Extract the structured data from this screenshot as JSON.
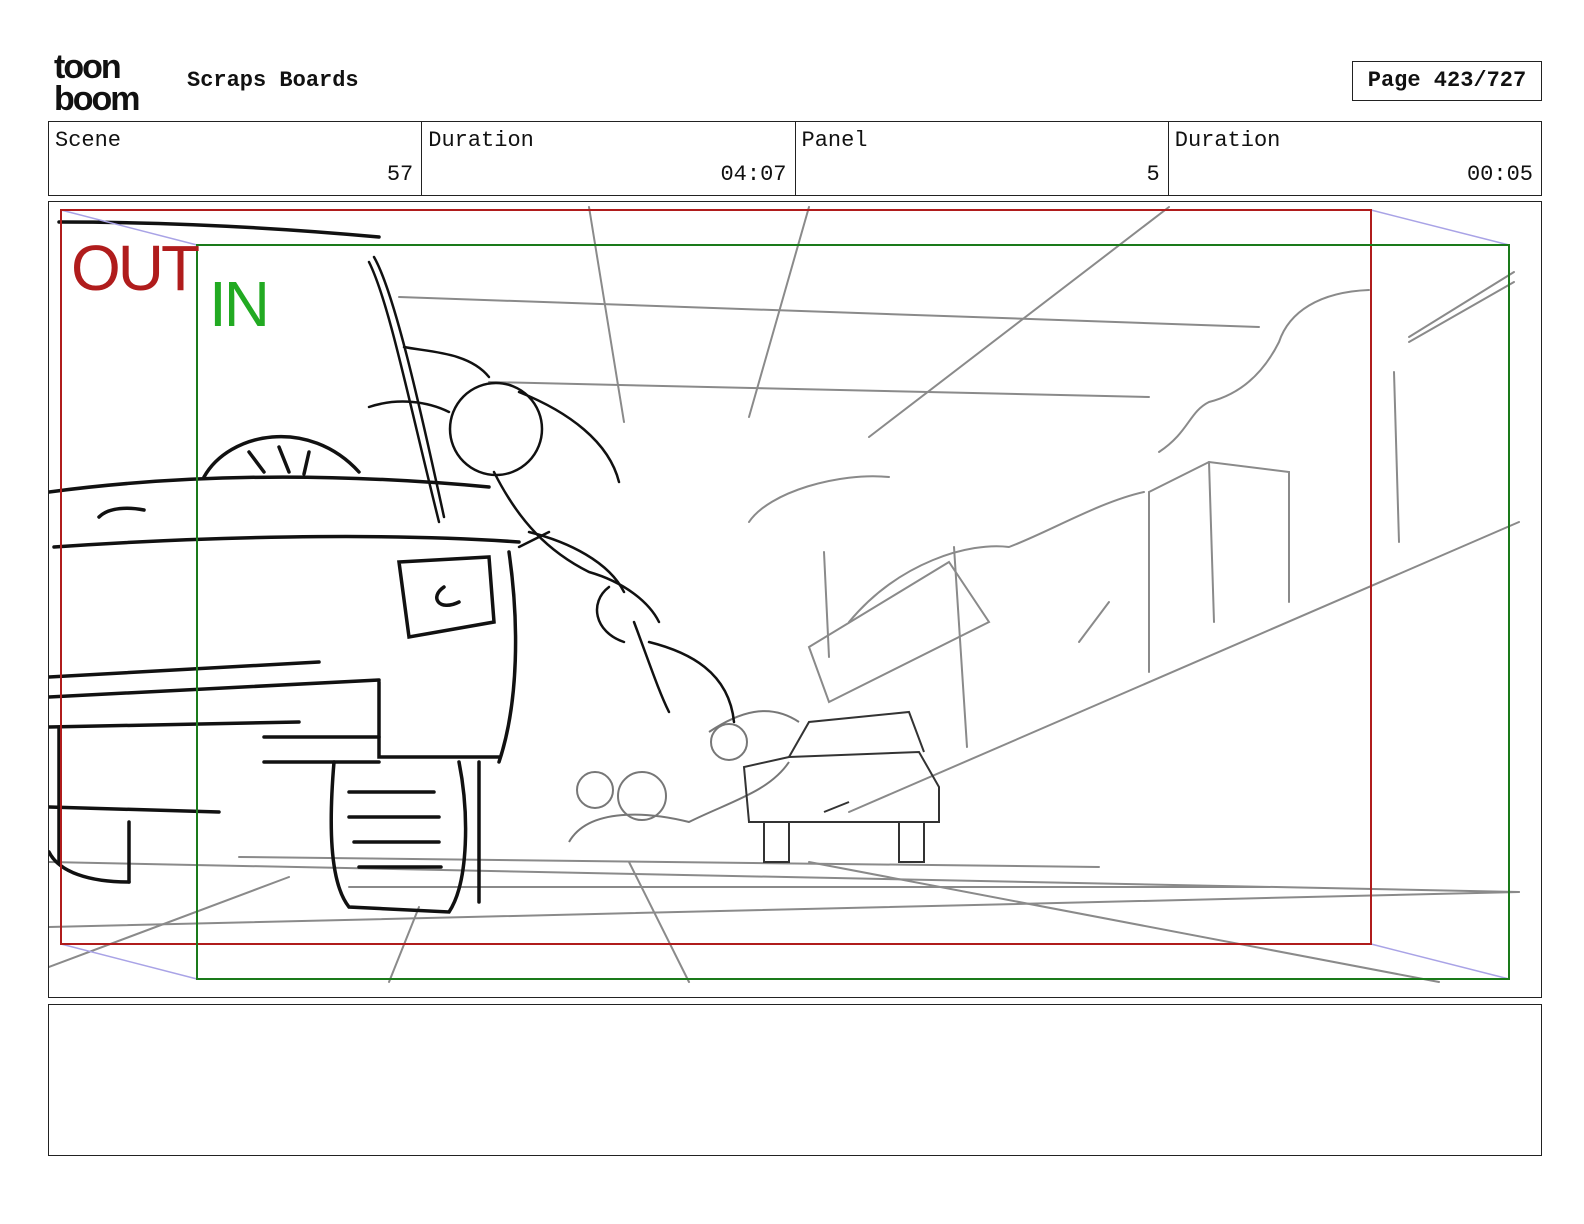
{
  "header": {
    "logo_top": "toon",
    "logo_bottom": "boom",
    "project_title": "Scraps Boards",
    "page_label": "Page 423/727"
  },
  "info": {
    "scene_label": "Scene",
    "scene_value": "57",
    "scene_duration_label": "Duration",
    "scene_duration_value": "04:07",
    "panel_label": "Panel",
    "panel_value": "5",
    "panel_duration_label": "Duration",
    "panel_duration_value": "00:05"
  },
  "panel": {
    "out_label": "OUT",
    "in_label": "IN",
    "colors": {
      "out_frame": "#b01c1c",
      "in_frame": "#1a7a1a",
      "in_text": "#22aa22",
      "sketch_dark": "#111111",
      "sketch_light": "#8a8a8a",
      "camera_path": "#a9a3e6"
    }
  },
  "notes": {
    "text": ""
  }
}
